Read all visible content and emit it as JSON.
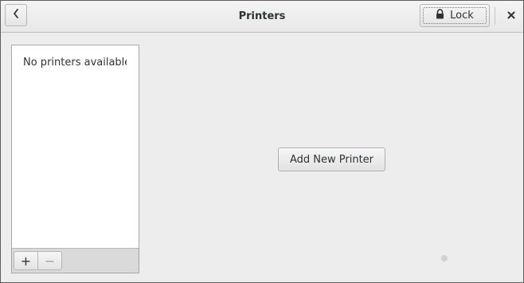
{
  "header": {
    "title": "Printers",
    "back_icon": "chevron-left-icon",
    "lock_label": "Lock",
    "lock_icon": "padlock-icon",
    "close_icon": "close-icon"
  },
  "printer_list": {
    "empty_text": "No printers available",
    "add_symbol": "+",
    "remove_symbol": "−"
  },
  "main": {
    "add_printer_label": "Add New Printer"
  },
  "colors": {
    "window_bg": "#ededed",
    "list_bg": "#ffffff",
    "text": "#2e3436"
  }
}
